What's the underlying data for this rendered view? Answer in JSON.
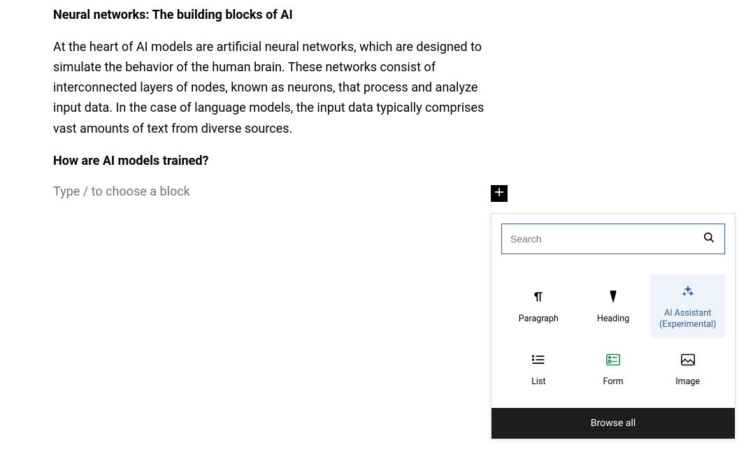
{
  "content": {
    "heading1": "Neural networks: The building blocks of AI",
    "paragraph1": "At the heart of AI models are artificial neural networks, which are designed to simulate the behavior of the human brain. These networks consist of interconnected layers of nodes, known as neurons, that process and analyze input data. In the case of language models, the input data typically comprises vast amounts of text from diverse sources.",
    "heading2": "How are AI models trained?",
    "placeholder_prompt": "Type / to choose a block"
  },
  "inserter": {
    "search_placeholder": "Search",
    "blocks": [
      {
        "label": "Paragraph"
      },
      {
        "label": "Heading"
      },
      {
        "label": "AI Assistant (Experimental)"
      },
      {
        "label": "List"
      },
      {
        "label": "Form"
      },
      {
        "label": "Image"
      }
    ],
    "browse_all_label": "Browse all"
  }
}
